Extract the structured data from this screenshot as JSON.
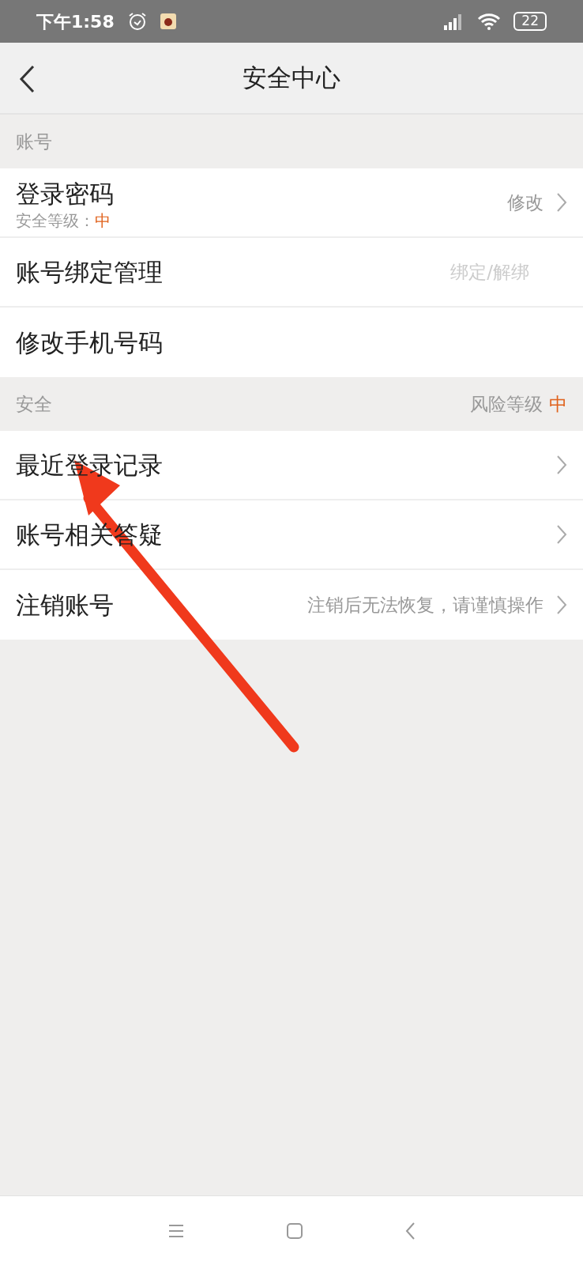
{
  "status_bar": {
    "time": "下午1:58",
    "battery": "22"
  },
  "header": {
    "title": "安全中心"
  },
  "sections": [
    {
      "title": "账号",
      "rows": [
        {
          "label": "登录密码",
          "sublabel": "安全等级：",
          "sublevel": "中",
          "value": "修改",
          "chevron": true
        },
        {
          "label": "账号绑定管理",
          "value": "绑定/解绑",
          "chevron": false
        },
        {
          "label": "修改手机号码",
          "chevron": false
        }
      ]
    },
    {
      "title": "安全",
      "aside_label": "风险等级",
      "aside_value": "中",
      "rows": [
        {
          "label": "最近登录记录",
          "chevron": true
        },
        {
          "label": "账号相关答疑",
          "chevron": true
        },
        {
          "label": "注销账号",
          "value": "注销后无法恢复，请谨慎操作",
          "chevron": true
        }
      ]
    }
  ],
  "annotation": {
    "kind": "arrow"
  }
}
